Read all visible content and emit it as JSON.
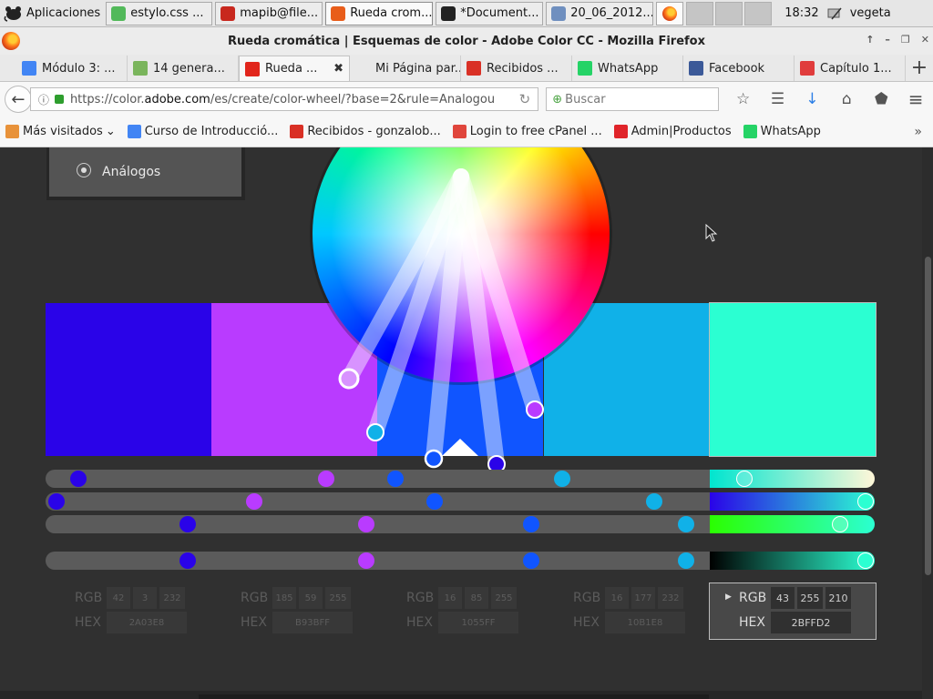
{
  "taskbar": {
    "apps_label": "Aplicaciones",
    "buttons": [
      {
        "label": "estylo.css ...",
        "color": "#52b95a"
      },
      {
        "label": "mapib@file...",
        "color": "#c8281e"
      },
      {
        "label": "Rueda crom...",
        "color": "#e85d1a"
      },
      {
        "label": "*Document...",
        "color": "#222222"
      },
      {
        "label": "20_06_2012...",
        "color": "#6f8fbf"
      }
    ],
    "clock": "18:32",
    "user": "vegeta"
  },
  "window": {
    "title": "Rueda cromática | Esquemas de color - Adobe Color CC - Mozilla Firefox"
  },
  "tabs": [
    {
      "label": "Módulo 3: ...",
      "icon": "google-icon",
      "color": "#4285f4"
    },
    {
      "label": "14 genera...",
      "icon": "shopify-icon",
      "color": "#7ab55c"
    },
    {
      "label": "Rueda ...",
      "icon": "adobe-icon",
      "color": "#e1251b",
      "active": true
    },
    {
      "label": "Mi Página par...",
      "icon": "blank-icon",
      "color": "#e9e9e9"
    },
    {
      "label": "Recibidos ...",
      "icon": "gmail-icon",
      "color": "#d93025"
    },
    {
      "label": "WhatsApp",
      "icon": "whatsapp-icon",
      "color": "#25d366"
    },
    {
      "label": "Facebook",
      "icon": "facebook-icon",
      "color": "#3b5998"
    },
    {
      "label": "Capítulo 1...",
      "icon": "book-icon",
      "color": "#e03c3c"
    }
  ],
  "nav": {
    "url_prefix": "https://color.",
    "url_domain": "adobe.com",
    "url_suffix": "/es/create/color-wheel/?base=2&rule=Analogou",
    "search_placeholder": "Buscar"
  },
  "bookmarks": [
    {
      "label": "Más visitados",
      "icon": "folder-icon",
      "color": "#e8923a"
    },
    {
      "label": "Curso de Introducció...",
      "icon": "google-icon",
      "color": "#4285f4"
    },
    {
      "label": "Recibidos - gonzalob...",
      "icon": "gmail-icon",
      "color": "#d93025"
    },
    {
      "label": "Login to free cPanel ...",
      "icon": "cpanel-icon",
      "color": "#e0463c"
    },
    {
      "label": "Admin|Productos",
      "icon": "admin-icon",
      "color": "#e0242a"
    },
    {
      "label": "WhatsApp",
      "icon": "whatsapp-icon",
      "color": "#25d366"
    }
  ],
  "rule": {
    "label": "Análogos"
  },
  "swatches": [
    {
      "color": "#2A03E8",
      "rgb": [
        "42",
        "3",
        "232"
      ],
      "hex": "2A03E8"
    },
    {
      "color": "#B93BFF",
      "rgb": [
        "185",
        "59",
        "255"
      ],
      "hex": "B93BFF"
    },
    {
      "color": "#1055FF",
      "rgb": [
        "16",
        "85",
        "255"
      ],
      "hex": "1055FF"
    },
    {
      "color": "#10B1E8",
      "rgb": [
        "16",
        "177",
        "232"
      ],
      "hex": "10B1E8"
    },
    {
      "color": "#2BFFD2",
      "rgb": [
        "43",
        "255",
        "210"
      ],
      "hex": "2BFFD2",
      "active": true
    }
  ],
  "labels": {
    "rgb": "RGB",
    "hex": "HEX"
  }
}
